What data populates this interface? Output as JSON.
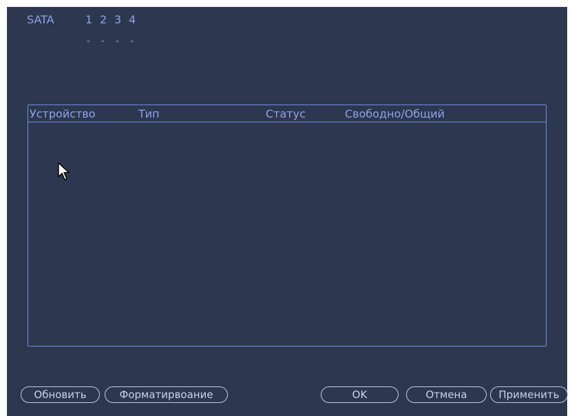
{
  "sata": {
    "label": "SATA",
    "ports": [
      "1",
      "2",
      "3",
      "4"
    ],
    "port_status": [
      "-",
      "-",
      "-",
      "-"
    ]
  },
  "table": {
    "columns": [
      "Устройство",
      "Тип",
      "Статус",
      "Свободно/Общий"
    ],
    "rows": []
  },
  "buttons": {
    "refresh": "Обновить",
    "format": "Форматирвоание",
    "ok": "OK",
    "cancel": "Отмена",
    "apply": "Применить"
  },
  "colors": {
    "panel_background": "#2d374f",
    "text_accent": "#8fa3e6",
    "table_border": "#6e8fe0",
    "button_border": "#c4ccdc"
  },
  "icons": {
    "cursor": "mouse-pointer-icon"
  }
}
